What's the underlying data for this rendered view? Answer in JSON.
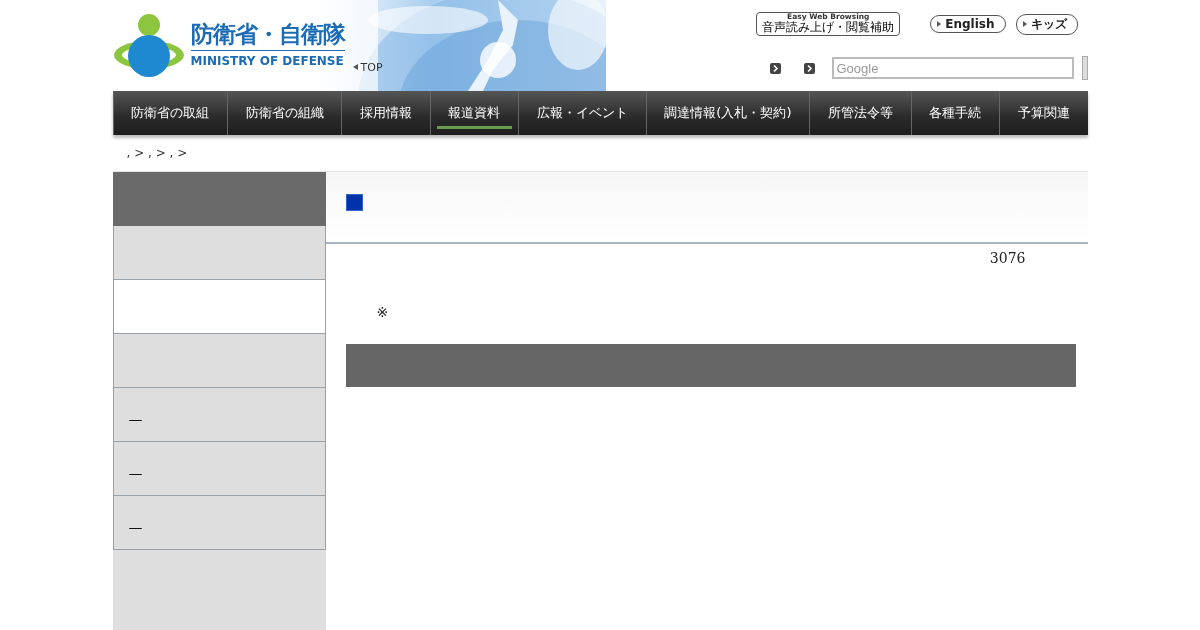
{
  "header": {
    "logo_title": "防衛省・自衛隊",
    "logo_subtitle": "MINISTRY OF DEFENSE",
    "top_link": "TOP",
    "easy_browsing": {
      "caption": "Easy Web Browsing",
      "label": "音声読み上げ・閲覧補助"
    },
    "language_links": [
      "English",
      "キッズ"
    ],
    "search": {
      "placeholder": "Google"
    }
  },
  "nav": [
    {
      "label": "防衛省の取組",
      "selected": false
    },
    {
      "label": "防衛省の組織",
      "selected": false
    },
    {
      "label": "採用情報",
      "selected": false
    },
    {
      "label": "報道資料",
      "selected": true
    },
    {
      "label": "広報・イベント",
      "selected": false
    },
    {
      "label": "調達情報(入札・契約)",
      "selected": false
    },
    {
      "label": "所管法令等",
      "selected": false
    },
    {
      "label": "各種手続",
      "selected": false
    },
    {
      "label": "予算関連",
      "selected": false
    }
  ],
  "breadcrumb": ", > , > , >",
  "sidebar": {
    "items": [
      {
        "selected": false
      },
      {
        "selected": true
      },
      {
        "selected": false
      },
      {
        "label": "—",
        "selected": false
      },
      {
        "label": "—",
        "selected": false
      },
      {
        "label": "—",
        "selected": false
      }
    ]
  },
  "main": {
    "count": "3076",
    "note": "※"
  }
}
